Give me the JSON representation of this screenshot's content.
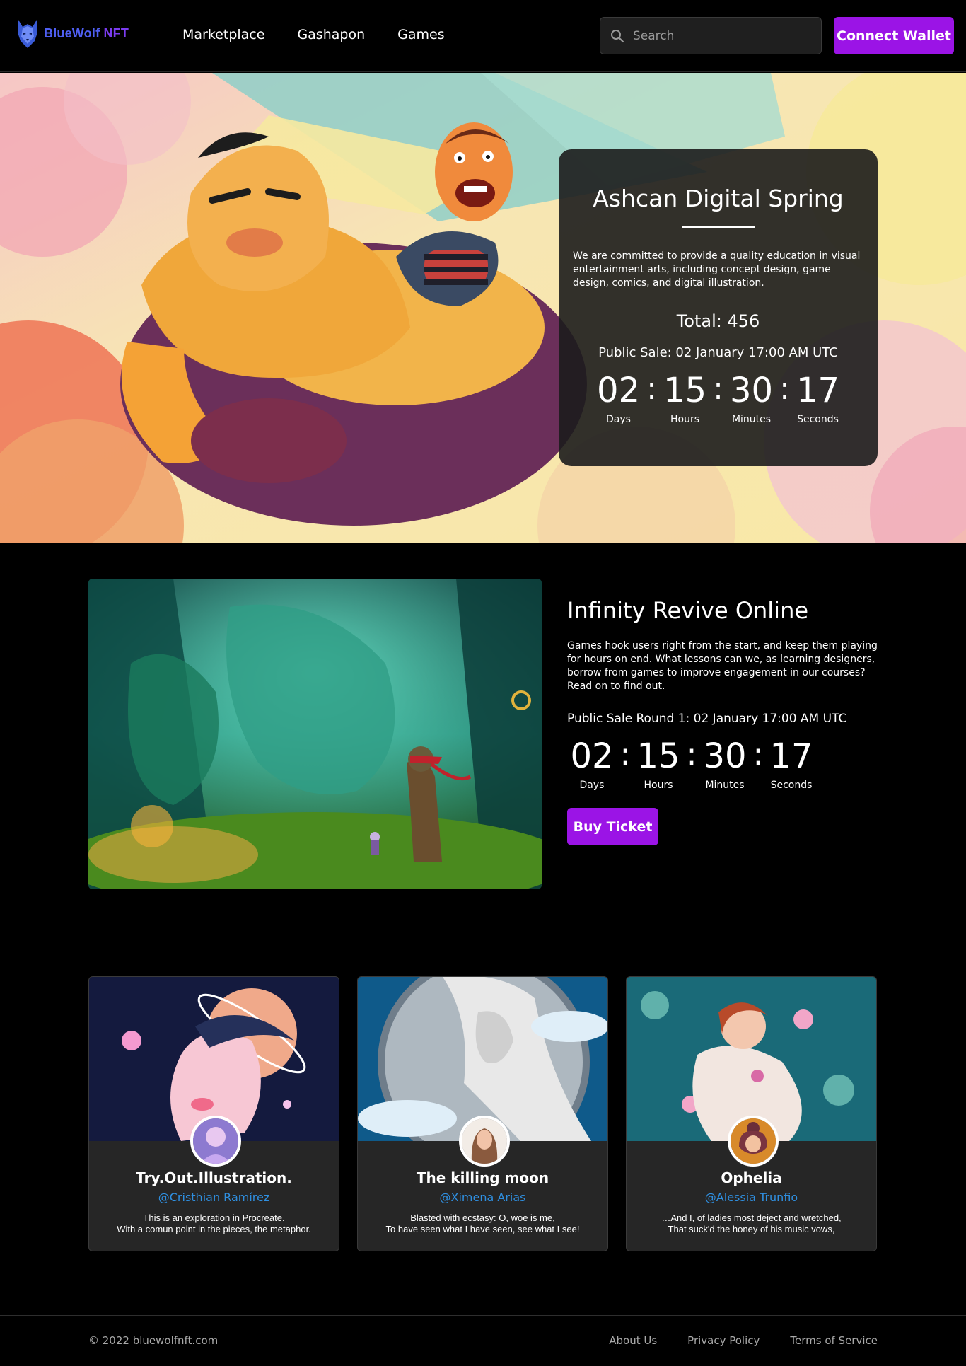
{
  "brand": {
    "name_part1": "BlueWolf",
    "name_part2": "NFT",
    "logo_icon": "wolf-logo-icon"
  },
  "nav": {
    "links": [
      "Marketplace",
      "Gashapon",
      "Games"
    ]
  },
  "search": {
    "placeholder": "Search",
    "value": ""
  },
  "connect_wallet": "Connect Wallet",
  "hero": {
    "title": "Ashcan Digital Spring",
    "description": "We are committed to provide a quality education in visual entertainment arts, including concept design, game design, comics, and digital illustration.",
    "total": "Total: 456",
    "public_sale": "Public Sale: 02 January 17:00 AM UTC",
    "countdown": {
      "days": "02",
      "hours": "15",
      "minutes": "30",
      "seconds": "17",
      "labels": {
        "days": "Days",
        "hours": "Hours",
        "minutes": "Minutes",
        "seconds": "Seconds"
      },
      "separator": ":"
    }
  },
  "feature": {
    "title": "Infinity Revive Online",
    "description": "Games hook users right from the start, and keep them playing for hours on end. What lessons can we, as learning designers, borrow from games to improve engagement in our courses? Read on to find out.",
    "public_sale": "Public Sale Round 1: 02 January 17:00 AM UTC",
    "countdown": {
      "days": "02",
      "hours": "15",
      "minutes": "30",
      "seconds": "17",
      "labels": {
        "days": "Days",
        "hours": "Hours",
        "minutes": "Minutes",
        "seconds": "Seconds"
      },
      "separator": ":"
    },
    "buy_label": "Buy Ticket"
  },
  "cards": [
    {
      "title": "Try.Out.Illustration.",
      "author": "@Cristhian Ramírez",
      "desc": "This is an exploration in Procreate.\nWith a comun point in the pieces, the metaphor."
    },
    {
      "title": "The killing moon",
      "author": "@Ximena Arias",
      "desc": "Blasted with ecstasy: O, woe is me,\nTo have seen what I have seen, see what I see!"
    },
    {
      "title": "Ophelia",
      "author": "@Alessia Trunfio",
      "desc": "…And I, of ladies most deject and wretched,\nThat suck'd the honey of his music vows,"
    }
  ],
  "footer": {
    "copyright": "© 2022 bluewolfnft.com",
    "links": [
      "About Us",
      "Privacy Policy",
      "Terms of Service"
    ]
  },
  "colors": {
    "accent": "#9b14e6",
    "link": "#2f8fe0",
    "card_bg": "#262626"
  }
}
